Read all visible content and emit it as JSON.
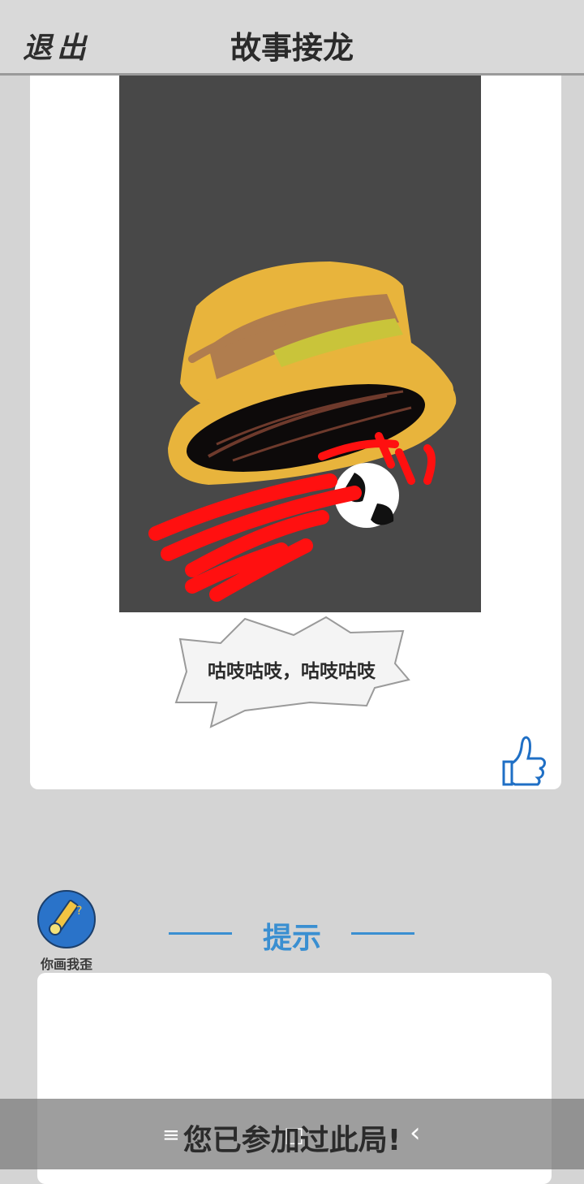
{
  "header": {
    "exit_label": "退出",
    "title": "故事接龙"
  },
  "story_card": {
    "caption": "咕吱咕吱，咕吱咕吱"
  },
  "app_badge": {
    "label": "你画我歪"
  },
  "hint": {
    "title": "提示"
  },
  "footer": {
    "status": "您已参加过此局!"
  },
  "nav": {
    "menu_icon": "≡",
    "home_icon": "□",
    "back_icon": "‹"
  },
  "colors": {
    "accent": "#3a8fd1",
    "background": "#d4d4d4",
    "canvas": "#484848"
  }
}
